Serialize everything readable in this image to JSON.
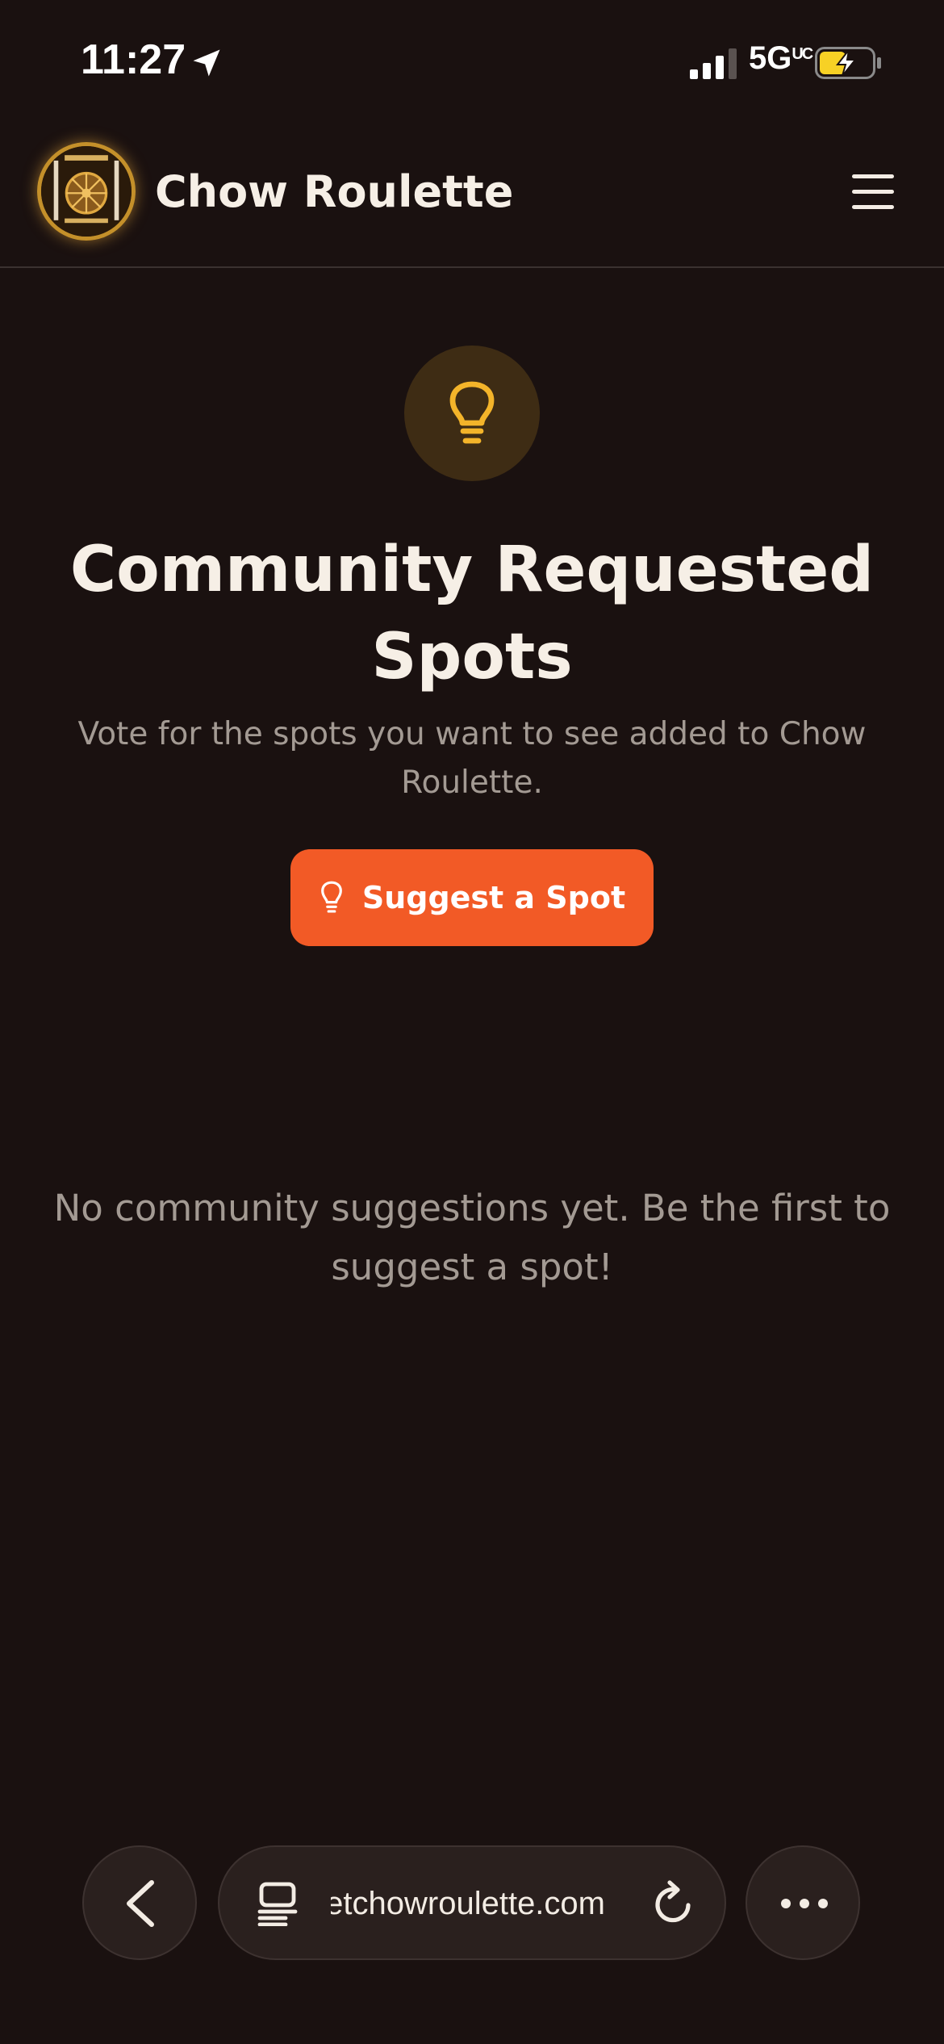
{
  "status_bar": {
    "time": "11:27",
    "network": "5G",
    "network_suffix": "UC",
    "icons": [
      "location-arrow-icon",
      "signal-bars-icon",
      "battery-charging-icon"
    ],
    "battery_level": 0.5
  },
  "header": {
    "brand": "Chow Roulette",
    "logo": "spin-the-wheel-logo",
    "menu_icon": "hamburger-menu-icon"
  },
  "hero": {
    "icon": "lightbulb-icon",
    "title_line1": "Community Requested",
    "title_line2": "Spots",
    "subtitle": "Vote for the spots you want to see added to Chow Roulette."
  },
  "suggest_button": {
    "label": "Suggest a Spot",
    "icon": "lightbulb-icon"
  },
  "empty_state": {
    "message": "No community suggestions yet. Be the first to suggest a spot!"
  },
  "browser_bar": {
    "url": "getchowroulette.com",
    "icons": [
      "back-chevron-icon",
      "tabs-icon",
      "reload-icon",
      "more-dots-icon"
    ]
  },
  "colors": {
    "background": "#1a1110",
    "accent": "#f25a26",
    "bulb": "#f3b42a",
    "badge_bg": "#3e2c14",
    "muted_text": "#a39a93",
    "primary_text": "#f6efe6"
  }
}
